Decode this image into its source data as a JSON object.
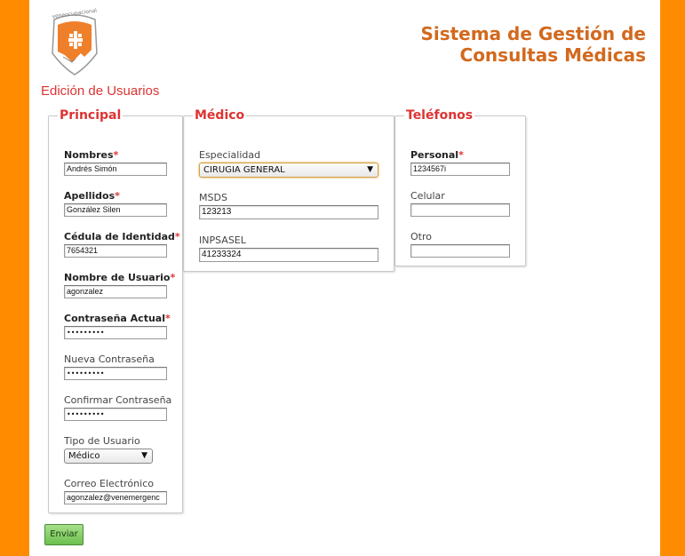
{
  "header": {
    "logo_text": "veneocupacional",
    "title_line1": "Sistema de Gestión de",
    "title_line2": "Consultas Médicas"
  },
  "page_title": "Edición de Usuarios",
  "principal": {
    "legend": "Principal",
    "nombres": {
      "label": "Nombres",
      "required": "*",
      "value": "Andrés Simón"
    },
    "apellidos": {
      "label": "Apellidos",
      "required": "*",
      "value": "González Silen"
    },
    "cedula": {
      "label": "Cédula de Identidad",
      "required": "*",
      "value": "7654321"
    },
    "usuario": {
      "label": "Nombre de Usuario",
      "required": "*",
      "value": "agonzalez"
    },
    "contrasena_actual": {
      "label": "Contraseña Actual",
      "required": "*",
      "value": "•••••••••"
    },
    "nueva_contrasena": {
      "label": "Nueva Contraseña",
      "value": "•••••••••"
    },
    "confirmar_contrasena": {
      "label": "Confirmar Contraseña",
      "value": "•••••••••"
    },
    "tipo_usuario": {
      "label": "Tipo de Usuario",
      "value": "Médico"
    },
    "correo": {
      "label": "Correo Electrónico",
      "value": "agonzalez@venemergenc"
    }
  },
  "medico": {
    "legend": "Médico",
    "especialidad": {
      "label": "Especialidad",
      "value": "CIRUGIA GENERAL"
    },
    "msds": {
      "label": "MSDS",
      "value": "123213"
    },
    "inpsasel": {
      "label": "INPSASEL",
      "value": "41233324"
    }
  },
  "telefonos": {
    "legend": "Teléfonos",
    "personal": {
      "label": "Personal",
      "required": "*",
      "value": "1234567i"
    },
    "celular": {
      "label": "Celular",
      "value": ""
    },
    "otro": {
      "label": "Otro",
      "value": ""
    }
  },
  "submit_label": "Enviar",
  "colors": {
    "accent": "#ff8c00",
    "title": "#d2691e",
    "legend": "#dd3333",
    "button": "#6cc04e"
  }
}
